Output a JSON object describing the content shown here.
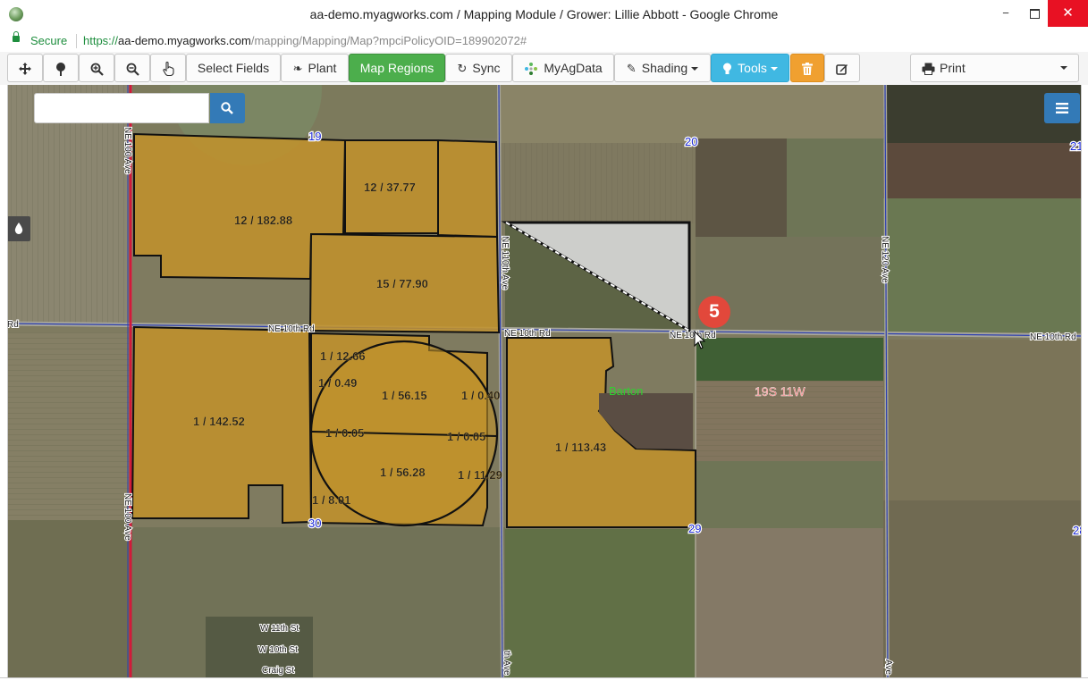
{
  "window": {
    "title": "aa-demo.myagworks.com / Mapping Module / Grower: Lillie Abbott - Google Chrome",
    "minimize": "−",
    "close": "✕"
  },
  "address_bar": {
    "secure_label": "Secure",
    "url_scheme": "https://",
    "url_domain": "aa-demo.myagworks.com",
    "url_path": "/mapping/Mapping/Map?mpciPolicyOID=189902072#"
  },
  "toolbar": {
    "select_fields": "Select Fields",
    "plant": "Plant",
    "map_regions": "Map Regions",
    "sync": "Sync",
    "myagdata": "MyAgData",
    "shading": "Shading",
    "tools": "Tools",
    "print": "Print"
  },
  "search": {
    "value": "",
    "placeholder": ""
  },
  "step_badge": "5",
  "map": {
    "section_numbers": {
      "s19": "19",
      "s20": "20",
      "s21": "21",
      "s29": "29",
      "s30": "30",
      "s28": "28"
    },
    "field_labels": [
      "12 / 37.77",
      "12 / 182.88",
      "15 / 77.90",
      "1 / 12.66",
      "1 / 0.49",
      "1 / 56.15",
      "1 / 0.40",
      "1 / 142.52",
      "1 / 0.05",
      "1 / 0.05",
      "1 / 56.28",
      "1 / 11.29",
      "1 / 8.01",
      "1 / 113.43"
    ],
    "roads": {
      "ne_10th_left": "NE 10th Rd",
      "ne_10th_mid": "NE 10th Rd",
      "ne_10th_center": "NE 10th Rd",
      "ne_10th_right": "NE 10th Rd",
      "rd_edge": "Rd",
      "ne_100_ave_bottom": "NE 100 Ave",
      "ne_100_ave_top": "NE 100 Ave",
      "ne_110th_ave": "NE 110th Ave",
      "ne_120_ave": "NE 120 Ave",
      "w_11th_st": "W 11th St",
      "w_10th_st": "W 10th St",
      "craig_st": "Craig St",
      "th_ave_bottom": "th Ave",
      "ave_bottom_right": "Ave"
    },
    "county_label": "Barton",
    "township_label": "19S 11W"
  },
  "colors": {
    "field_fill": "#c2922a",
    "field_border": "#111111",
    "selection_fill": "#d9d9d9",
    "section_label": "#1f2bd6",
    "county_label": "#2fd12f",
    "township_label": "#f06a6a",
    "boundary_red": "#d11a3a",
    "accent_blue": "#337ab7",
    "green_button": "#4cae4c",
    "cyan_button": "#40b8e2",
    "orange_button": "#f0a030"
  },
  "icons": {
    "pan": "crosshair-move-icon",
    "plant": "tree-icon",
    "zoom_in": "zoom-in-icon",
    "zoom_out": "zoom-out-icon",
    "hand": "hand-pointer-icon",
    "leaf": "leaf-icon",
    "sync": "refresh-icon",
    "myagdata": "myagdata-logo-icon",
    "shading": "pencil-icon",
    "tools": "lightbulb-icon",
    "trash": "trash-icon",
    "edit": "edit-square-icon",
    "print": "printer-icon",
    "search": "search-icon",
    "layers": "list-menu-icon",
    "drop": "water-drop-icon"
  }
}
